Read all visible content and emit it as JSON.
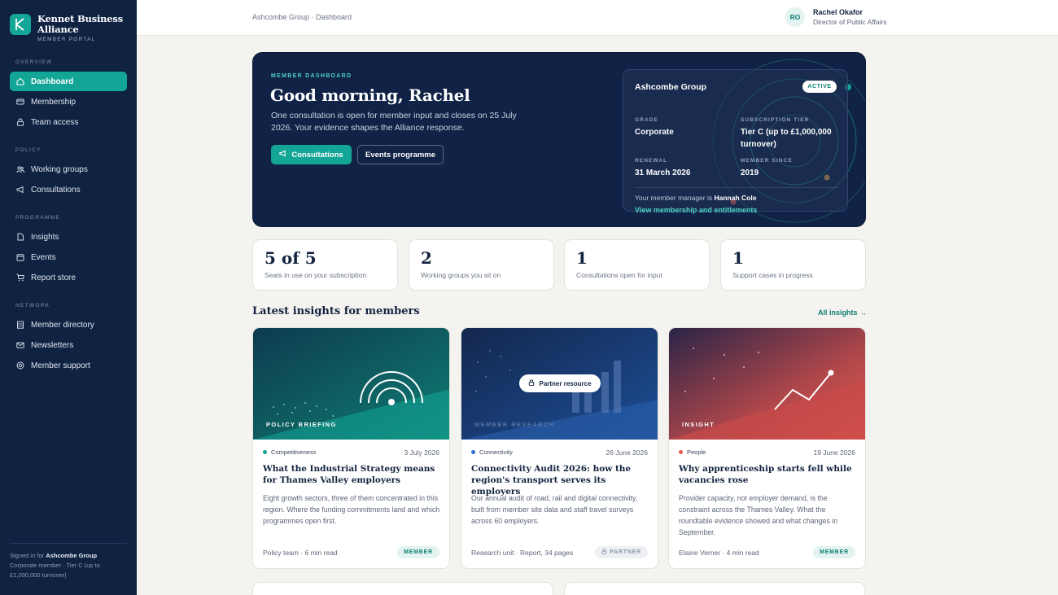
{
  "brand": {
    "name_line1": "Kennet Business",
    "name_line2": "Alliance",
    "subtitle": "MEMBER PORTAL",
    "logo_letter": "K"
  },
  "sidebar": {
    "sections": {
      "overview": "OVERVIEW",
      "policy": "POLICY",
      "programme": "PROGRAMME",
      "network": "NETWORK"
    },
    "items": {
      "dashboard": "Dashboard",
      "membership": "Membership",
      "team_access": "Team access",
      "working_groups": "Working groups",
      "consultations": "Consultations",
      "insights": "Insights",
      "events": "Events",
      "report_store": "Report store",
      "member_directory": "Member directory",
      "newsletters": "Newsletters",
      "member_support": "Member support"
    },
    "signed_in_prefix": "Signed in for ",
    "signed_in_org": "Ashcombe Group",
    "signed_in_detail": "Corporate member · Tier C (up to £1,000,000 turnover)"
  },
  "header": {
    "breadcrumb": "Ashcombe Group · Dashboard",
    "avatar_initials": "RO",
    "user_name": "Rachel Okafor",
    "user_role": "Director of Public Affairs"
  },
  "hero": {
    "eyebrow": "MEMBER DASHBOARD",
    "title": "Good morning, Rachel",
    "text": "One consultation is open for member input and closes on 25 July 2026. Your evidence shapes the Alliance response.",
    "primary_button": "Consultations",
    "secondary_button": "Events programme"
  },
  "member_card": {
    "org": "Ashcombe Group",
    "status": "ACTIVE",
    "grade_label": "GRADE",
    "grade": "Corporate",
    "tier_label": "SUBSCRIPTION TIER",
    "tier": "Tier C (up to £1,000,000 turnover)",
    "renewal_label": "RENEWAL",
    "renewal": "31 March 2026",
    "since_label": "MEMBER SINCE",
    "since": "2019",
    "manager_prefix": "Your member manager is ",
    "manager": "Hannah Cole",
    "link": "View membership and entitlements"
  },
  "stats": [
    {
      "value": "5 of 5",
      "label": "Seats in use on your subscription"
    },
    {
      "value": "2",
      "label": "Working groups you sit on"
    },
    {
      "value": "1",
      "label": "Consultations open for input"
    },
    {
      "value": "1",
      "label": "Support cases in progress"
    }
  ],
  "insights": {
    "title": "Latest insights for members",
    "all_link": "All insights →",
    "cards": [
      {
        "image_label": "POLICY BRIEFING",
        "tag": "Competitiveness",
        "tag_color": "#13a596",
        "date": "3 July 2026",
        "title": "What the Industrial Strategy means for Thames Valley employers",
        "desc": "Eight growth sectors, three of them concentrated in this region. Where the funding commitments land and which programmes open first.",
        "meta": "Policy team · 6 min read",
        "badge": "MEMBER"
      },
      {
        "image_label": "MEMBER RESEARCH",
        "overlay": "Partner resource",
        "tag": "Connectivity",
        "tag_color": "#2b6fd6",
        "date": "26 June 2026",
        "title": "Connectivity Audit 2026: how the region's transport serves its employers",
        "desc": "Our annual audit of road, rail and digital connectivity, built from member site data and staff travel surveys across 60 employers.",
        "meta": "Research unit · Report, 34 pages",
        "badge": "PARTNER"
      },
      {
        "image_label": "INSIGHT",
        "tag": "People",
        "tag_color": "#e5594f",
        "date": "19 June 2026",
        "title": "Why apprenticeship starts fell while vacancies rose",
        "desc": "Provider capacity, not employer demand, is the constraint across the Thames Valley. What the roundtable evidence showed and what changes in September.",
        "meta": "Elaine Verner · 4 min read",
        "badge": "MEMBER"
      }
    ]
  }
}
